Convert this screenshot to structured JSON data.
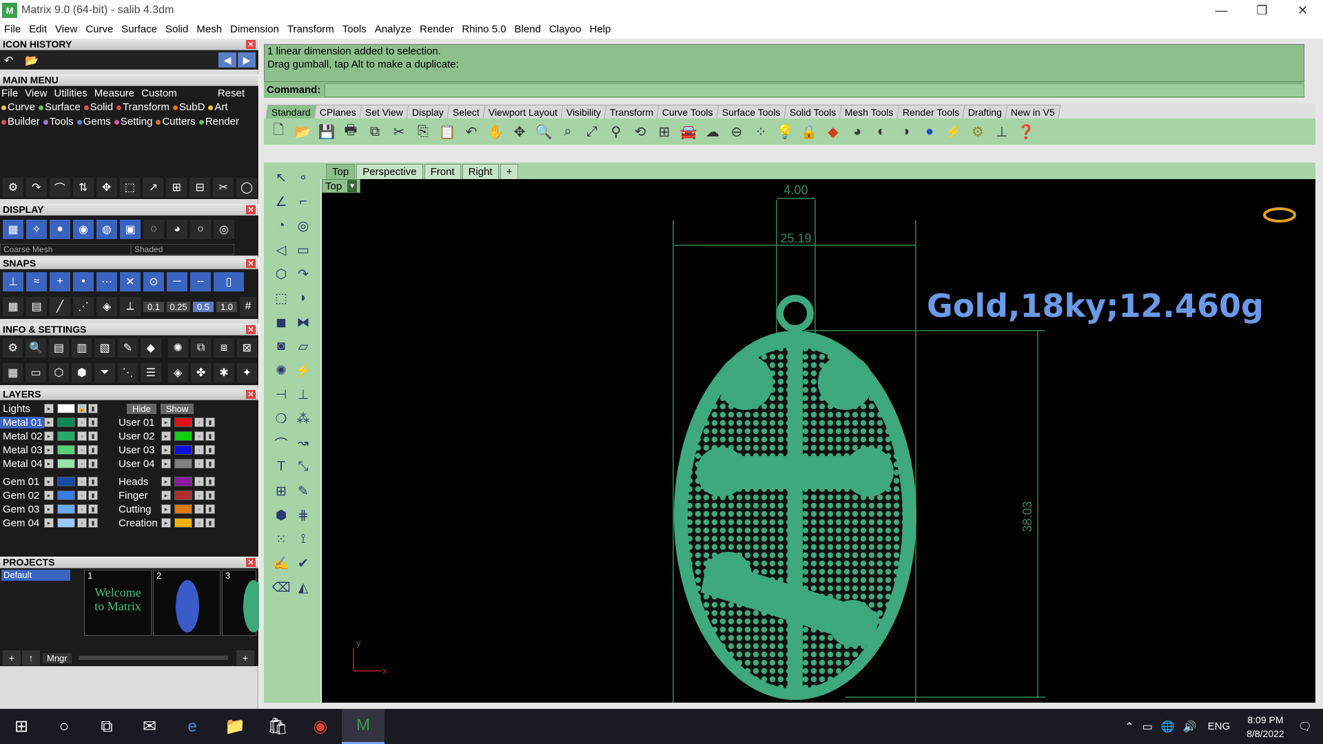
{
  "window": {
    "title": "Matrix 9.0 (64-bit) - salib 4.3dm",
    "app_icon": "matrix-icon"
  },
  "menubar": [
    "File",
    "Edit",
    "View",
    "Curve",
    "Surface",
    "Solid",
    "Mesh",
    "Dimension",
    "Transform",
    "Tools",
    "Analyze",
    "Render",
    "Rhino 5.0",
    "Blend",
    "Clayoo",
    "Help"
  ],
  "panels": {
    "icon_history": "ICON HISTORY",
    "main_menu": "MAIN MENU",
    "display": "DISPLAY",
    "snaps": "SNAPS",
    "info_settings": "INFO & SETTINGS",
    "layers": "LAYERS",
    "projects": "PROJECTS"
  },
  "main_menu": {
    "menu": [
      "File",
      "View",
      "Utilities",
      "Measure",
      "Custom"
    ],
    "reset": "Reset",
    "row1": [
      "Curve",
      "Surface",
      "Solid",
      "Transform",
      "SubD",
      "Art"
    ],
    "row2": [
      "Builder",
      "Tools",
      "Gems",
      "Setting",
      "Cutters",
      "Render"
    ]
  },
  "display": {
    "mesh_select": "Coarse Mesh",
    "shade_select": "Shaded"
  },
  "snaps": {
    "values": [
      "0.1",
      "0.25",
      "0.5",
      "1.0"
    ]
  },
  "layers": {
    "lights": "Lights",
    "hide": "Hide",
    "show": "Show",
    "left": [
      {
        "name": "Metal 01",
        "color": "#0a8a5a",
        "selected": true
      },
      {
        "name": "Metal 02",
        "color": "#2aaa6a"
      },
      {
        "name": "Metal 03",
        "color": "#5ad07a"
      },
      {
        "name": "Metal 04",
        "color": "#9ae0aa"
      },
      {
        "name": "Gem 01",
        "color": "#1a4ab0"
      },
      {
        "name": "Gem 02",
        "color": "#3a7ae0"
      },
      {
        "name": "Gem 03",
        "color": "#6aaaf0"
      },
      {
        "name": "Gem 04",
        "color": "#9ac8f8"
      }
    ],
    "right": [
      {
        "name": "User 01",
        "color": "#e01010"
      },
      {
        "name": "User 02",
        "color": "#10d010"
      },
      {
        "name": "User 03",
        "color": "#1010e0"
      },
      {
        "name": "User 04",
        "color": "#808080"
      },
      {
        "name": "Heads",
        "color": "#8a1aa0"
      },
      {
        "name": "Finger",
        "color": "#b03030"
      },
      {
        "name": "Cutting",
        "color": "#e07a10"
      },
      {
        "name": "Creation",
        "color": "#f0b010"
      }
    ]
  },
  "projects": {
    "default": "Default",
    "thumbs": [
      {
        "num": "1",
        "text": "Welcome to Matrix"
      },
      {
        "num": "2",
        "text": ""
      },
      {
        "num": "3",
        "text": ""
      }
    ],
    "mngr": "Mngr"
  },
  "command": {
    "history": [
      "1 linear dimension added to selection.",
      "Drag gumball, tap Alt to make a duplicate:"
    ],
    "prompt": "Command:"
  },
  "toolbar_tabs": [
    "Standard",
    "CPlanes",
    "Set View",
    "Display",
    "Select",
    "Viewport Layout",
    "Visibility",
    "Transform",
    "Curve Tools",
    "Surface Tools",
    "Solid Tools",
    "Mesh Tools",
    "Render Tools",
    "Drafting",
    "New in V5"
  ],
  "viewport_tabs": [
    "Top",
    "Perspective",
    "Front",
    "Right"
  ],
  "viewport": {
    "label": "Top",
    "annotation": "Gold,18ky;12.460g",
    "dim_small": "4.00",
    "dim_width": "25.19",
    "dim_height": "38.03",
    "axis_y": "y",
    "axis_x": "x"
  },
  "taskbar": {
    "lang": "ENG",
    "time": "8:09 PM",
    "date": "8/8/2022"
  },
  "colors": {
    "accent_green": "#8cbf8c",
    "pendant": "#3ea87e",
    "annotation": "#6a9ae8"
  }
}
